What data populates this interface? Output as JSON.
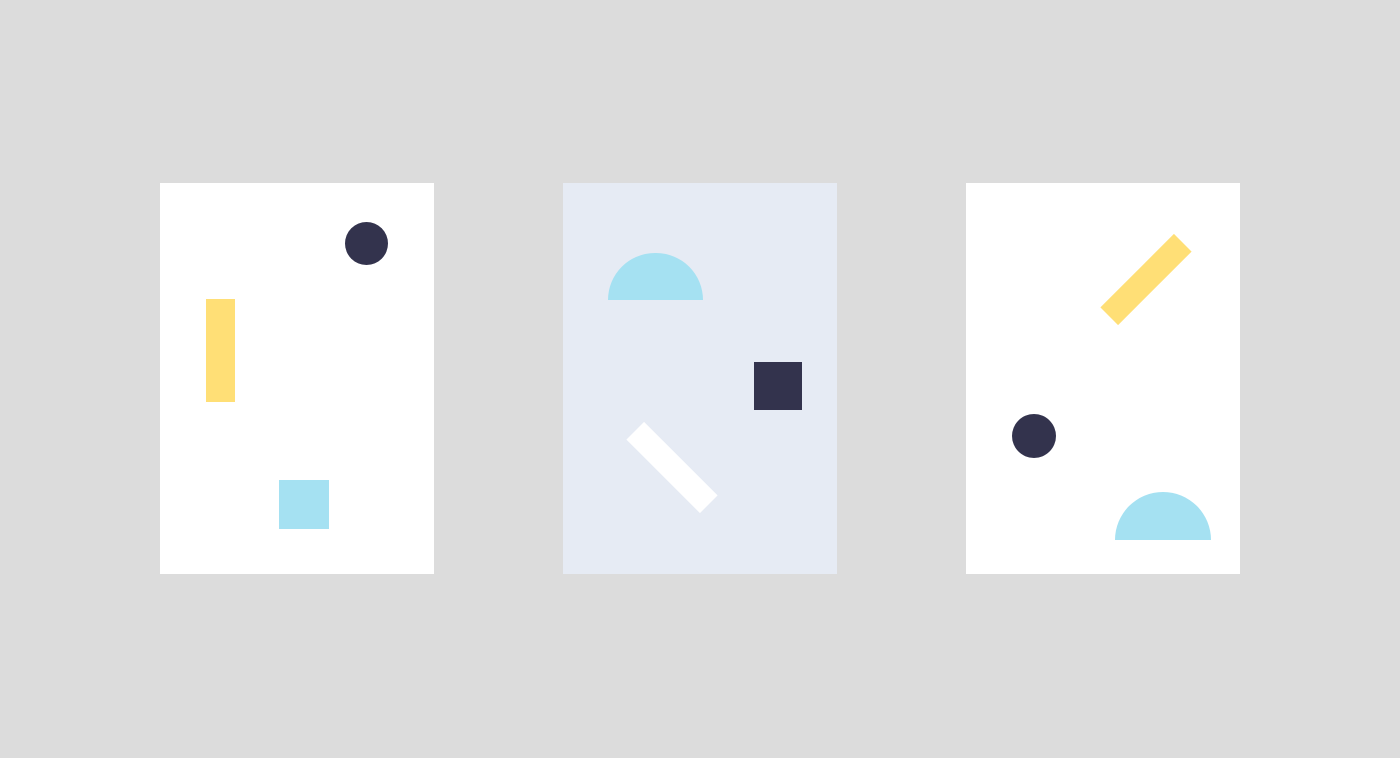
{
  "palette": {
    "page_background": "#dcdcdc",
    "navy": "#33334d",
    "yellow": "#ffdf76",
    "sky": "#a5e1f2",
    "white": "#ffffff",
    "pale_blue": "#e6ebf4"
  },
  "cards": [
    {
      "background": "#ffffff",
      "shapes": [
        {
          "kind": "circle",
          "icon": "circle-shape",
          "color": "#33334d"
        },
        {
          "kind": "vertical-bar",
          "icon": "bar-shape",
          "color": "#ffdf76"
        },
        {
          "kind": "square",
          "icon": "square-shape",
          "color": "#a5e1f2"
        }
      ]
    },
    {
      "background": "#e6ebf4",
      "shapes": [
        {
          "kind": "semicircle",
          "icon": "semicircle-shape",
          "color": "#a5e1f2"
        },
        {
          "kind": "square",
          "icon": "square-shape",
          "color": "#33334d"
        },
        {
          "kind": "diagonal-bar",
          "icon": "bar-shape",
          "color": "#ffffff"
        }
      ]
    },
    {
      "background": "#ffffff",
      "shapes": [
        {
          "kind": "diagonal-bar",
          "icon": "bar-shape",
          "color": "#ffdf76"
        },
        {
          "kind": "circle",
          "icon": "circle-shape",
          "color": "#33334d"
        },
        {
          "kind": "semicircle",
          "icon": "semicircle-shape",
          "color": "#a5e1f2"
        }
      ]
    }
  ]
}
